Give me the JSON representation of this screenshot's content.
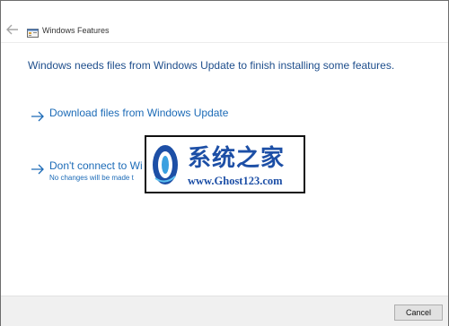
{
  "window": {
    "title": "Windows Features"
  },
  "main": {
    "headline": "Windows needs files from Windows Update to finish installing some features.",
    "options": [
      {
        "label": "Download files from Windows Update"
      },
      {
        "label": "Don't connect to Wi",
        "sub": "No changes will be made t"
      }
    ]
  },
  "watermark": {
    "chinese": "系统之家",
    "url": "www.Ghost123.com"
  },
  "footer": {
    "cancel_label": "Cancel"
  },
  "colors": {
    "link": "#1c6bb7",
    "headline": "#1e4e8c",
    "watermark": "#1d4fa6",
    "footer_bg": "#f0f0f0"
  },
  "icons": [
    "back-arrow-icon",
    "windows-features-icon",
    "arrow-right-icon",
    "watermark-logo-icon"
  ]
}
